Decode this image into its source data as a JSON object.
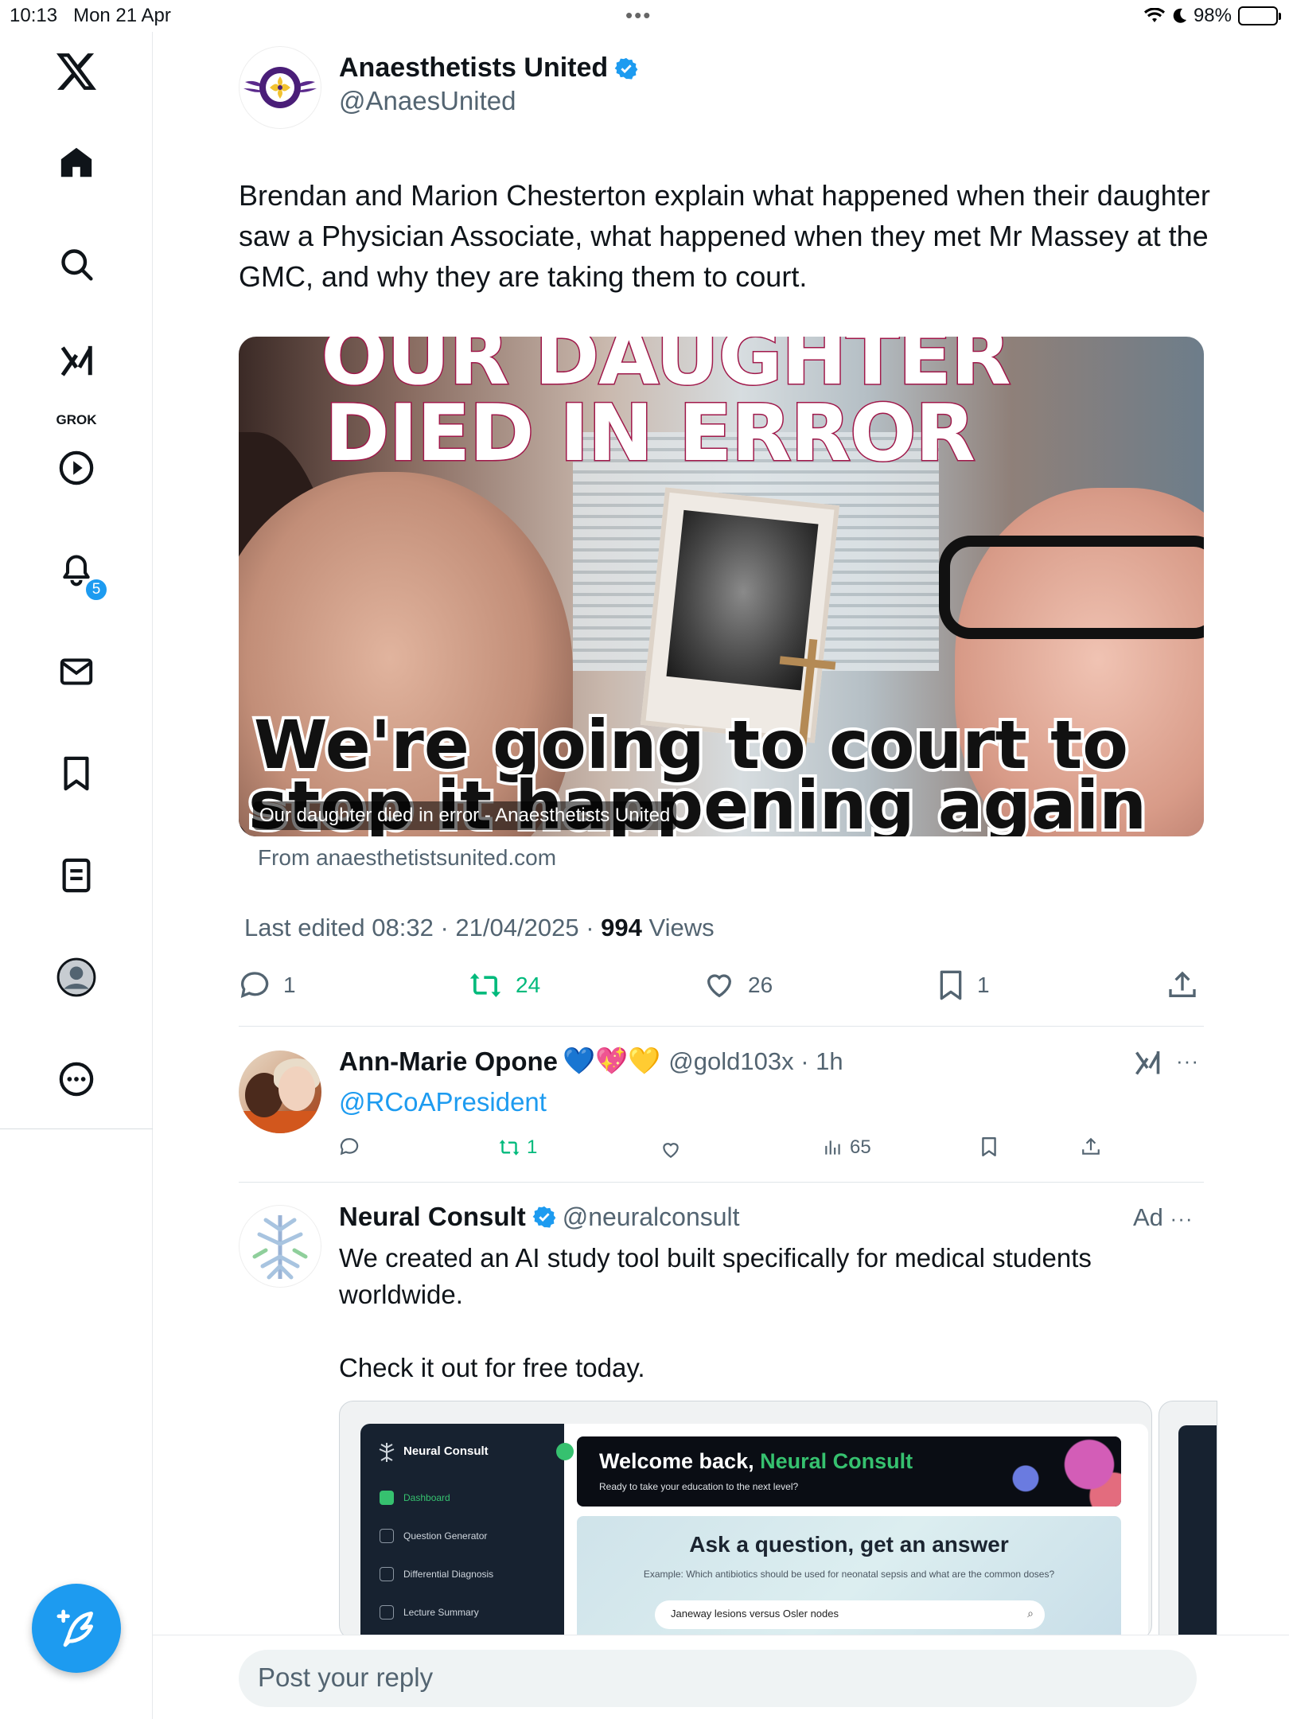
{
  "status_bar": {
    "time": "10:13",
    "date": "Mon 21 Apr",
    "battery": "98%"
  },
  "sidebar": {
    "grok_label": "GROK",
    "notifications_badge": "5"
  },
  "tweet": {
    "author_name": "Anaesthetists United",
    "author_handle": "@AnaesUnited",
    "avatar_text": "ANAESTHETISTS UNITED",
    "text": "Brendan and Marion Chesterton  explain what happened when their daughter saw a Physician Associate, what happened when they met Mr Massey at the GMC, and why they are taking them to court.",
    "media": {
      "headline_1": "OUR DAUGHTER",
      "headline_2": "DIED IN ERROR",
      "subline_1": "We're going to court to",
      "subline_2": "stop it happening again",
      "caption": "Our daughter died in error - Anaesthetists United"
    },
    "link_source": "From anaesthetistsunited.com",
    "edited": "Last edited 08:32 · 21/04/2025",
    "views_count": "994",
    "views_label": "Views",
    "replies": "1",
    "reposts": "24",
    "likes": "26",
    "bookmarks": "1"
  },
  "reply": {
    "author_name": "Ann-Marie Opone",
    "emojis": "💙💖💛",
    "handle_time": "@gold103x · 1h",
    "mention": "@RCoAPresident",
    "reposts": "1",
    "views": "65"
  },
  "ad": {
    "author_name": "Neural Consult",
    "author_handle": "@neuralconsult",
    "ad_label": "Ad",
    "text_1": "We created an AI study tool built specifically for medical students worldwide.",
    "text_2": "Check it out for free today.",
    "card": {
      "brand": "Neural Consult",
      "nav": [
        "Dashboard",
        "Question Generator",
        "Differential Diagnosis",
        "Lecture Summary"
      ],
      "welcome_prefix": "Welcome back, ",
      "welcome_name": "Neural Consult",
      "ready": "Ready to take your education to the next level?",
      "ask_title": "Ask a question, get an answer",
      "ask_example": "Example: Which antibiotics should be used for neonatal sepsis and what are the common doses?",
      "ask_input": "Janeway lesions versus Osler nodes"
    }
  },
  "reply_bar": {
    "placeholder": "Post your reply"
  },
  "colors": {
    "accent": "#1d9bf0",
    "repost_green": "#00ba7c",
    "text_secondary": "#536471"
  }
}
